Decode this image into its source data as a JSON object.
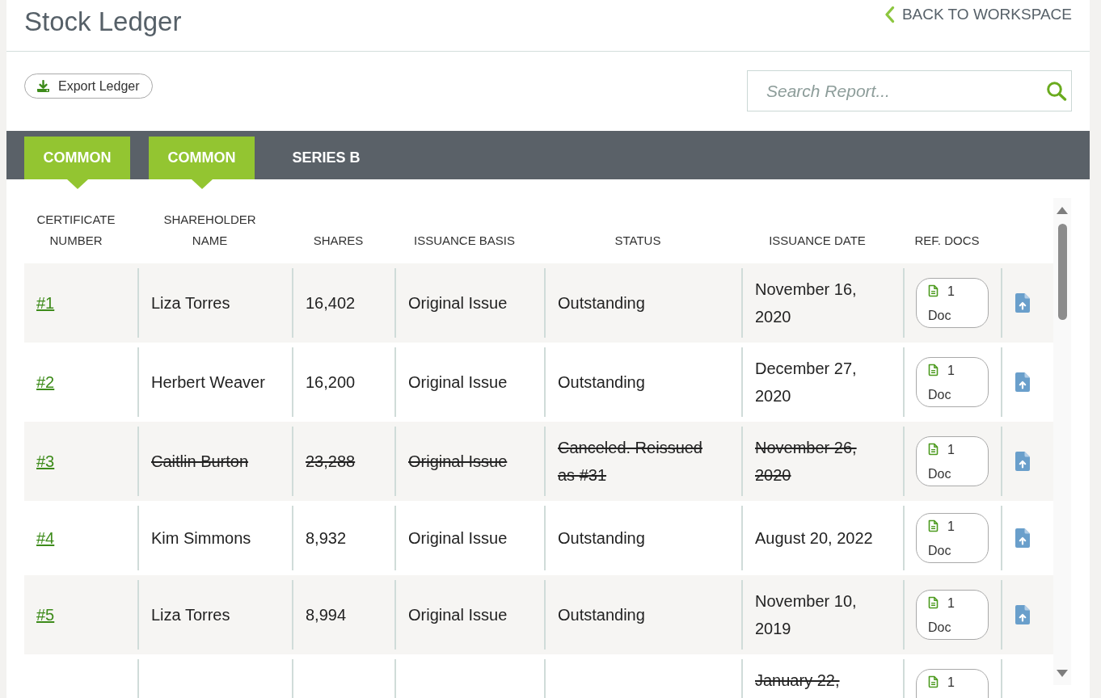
{
  "page": {
    "title": "Stock Ledger",
    "back_link": "BACK TO WORKSPACE"
  },
  "toolbar": {
    "export_button": "Export Ledger",
    "search": {
      "placeholder": "Search Report..."
    }
  },
  "tabs": [
    {
      "label": "COMMON",
      "selected": true
    },
    {
      "label": "COMMON",
      "selected": true
    },
    {
      "label": "SERIES B",
      "selected": false
    }
  ],
  "table": {
    "columns": [
      "CERTIFICATE NUMBER",
      "SHAREHOLDER NAME",
      "SHARES",
      "ISSUANCE BASIS",
      "STATUS",
      "ISSUANCE DATE",
      "REF. DOCS"
    ],
    "rows": [
      {
        "kind": "full",
        "canceled": false,
        "certificate": "#1",
        "shareholder": "Liza Torres",
        "shares": "16,402",
        "basis": "Original Issue",
        "status": "Outstanding",
        "issuance_date": "November 16, 2020",
        "ref_docs": "1 Doc"
      },
      {
        "kind": "full",
        "canceled": false,
        "certificate": "#2",
        "shareholder": "Herbert Weaver",
        "shares": "16,200",
        "basis": "Original Issue",
        "status": "Outstanding",
        "issuance_date": "December 27, 2020",
        "ref_docs": "1 Doc"
      },
      {
        "kind": "full",
        "canceled": true,
        "certificate": "#3",
        "shareholder": "Caitlin Burton",
        "shares": "23,288",
        "basis": "Original Issue",
        "status": "Canceled. Reissued as #31",
        "issuance_date": "November 26, 2020",
        "ref_docs": "1 Doc"
      },
      {
        "kind": "full",
        "canceled": false,
        "certificate": "#4",
        "shareholder": "Kim Simmons",
        "shares": "8,932",
        "basis": "Original Issue",
        "status": "Outstanding",
        "issuance_date": "August 20, 2022",
        "ref_docs": "1 Doc"
      },
      {
        "kind": "full",
        "canceled": false,
        "certificate": "#5",
        "shareholder": "Liza Torres",
        "shares": "8,994",
        "basis": "Original Issue",
        "status": "Outstanding",
        "issuance_date": "November 10, 2019",
        "ref_docs": "1 Doc"
      },
      {
        "kind": "partial",
        "canceled": true,
        "issuance_date": "January 22,",
        "ref_docs": "1"
      }
    ]
  }
}
